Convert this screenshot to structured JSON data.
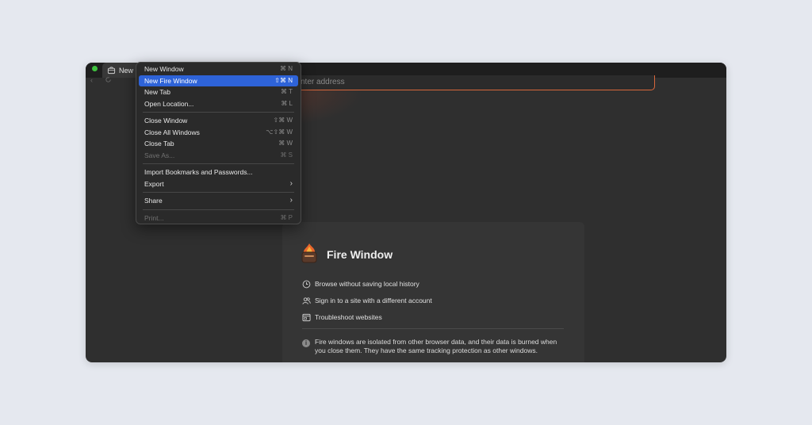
{
  "tab": {
    "title": "New F"
  },
  "address": {
    "placeholder": "nter address"
  },
  "menu": {
    "groups": [
      [
        {
          "label": "New Window",
          "shortcut": "⌘ N"
        },
        {
          "label": "New Fire Window",
          "shortcut": "⇧⌘ N",
          "selected": true
        },
        {
          "label": "New Tab",
          "shortcut": "⌘ T"
        },
        {
          "label": "Open Location...",
          "shortcut": "⌘ L"
        }
      ],
      [
        {
          "label": "Close Window",
          "shortcut": "⇧⌘ W"
        },
        {
          "label": "Close All Windows",
          "shortcut": "⌥⇧⌘ W"
        },
        {
          "label": "Close Tab",
          "shortcut": "⌘ W"
        },
        {
          "label": "Save As...",
          "shortcut": "⌘ S",
          "disabled": true
        }
      ],
      [
        {
          "label": "Import Bookmarks and Passwords..."
        },
        {
          "label": "Export",
          "submenu": true
        }
      ],
      [
        {
          "label": "Share",
          "submenu": true
        }
      ],
      [
        {
          "label": "Print...",
          "shortcut": "⌘ P",
          "disabled": true
        }
      ]
    ]
  },
  "card": {
    "title": "Fire Window",
    "features": [
      {
        "icon": "clock-icon",
        "text": "Browse without saving local history"
      },
      {
        "icon": "people-icon",
        "text": "Sign in to a site with a different account"
      },
      {
        "icon": "browser-icon",
        "text": "Troubleshoot websites"
      }
    ],
    "info": "Fire windows are isolated from other browser data, and their data is burned when you close them. They have the same tracking protection as other windows."
  }
}
